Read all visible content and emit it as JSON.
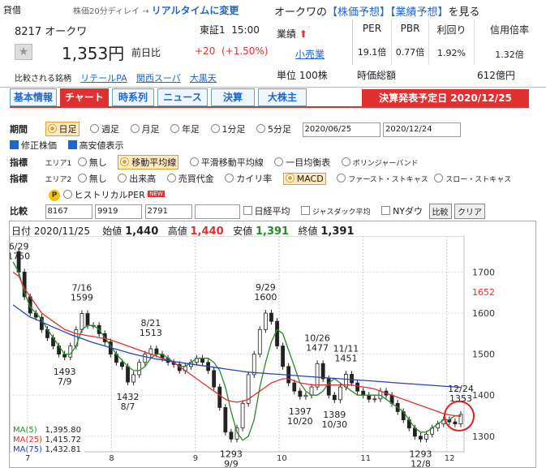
{
  "header": {
    "shinyo": "貸借",
    "delay_note": "株価20分ディレイ →",
    "realtime_link": "リアルタイムに変更",
    "company_short": "オークワの",
    "forecast_links": [
      "【株価予想】",
      "【業績予想】"
    ],
    "forecast_suffix": "を見る"
  },
  "stock": {
    "code": "8217",
    "name": "オークワ",
    "exchange": "東証1",
    "time": "15:00",
    "price": "1,353円",
    "prev_label": "前日比",
    "change": "+20",
    "change_pct": "(+1.50%)",
    "compare_label": "比較される銘柄",
    "compare_links": [
      "リテールPA",
      "関西スーパ",
      "大黒天"
    ],
    "gyoseki_label": "業績",
    "gyoseki_arrow": "⬆",
    "sector": "小売業",
    "unit": "単位 100株",
    "metrics": [
      {
        "h": "PER",
        "v": "19.1倍"
      },
      {
        "h": "PBR",
        "v": "0.77倍"
      },
      {
        "h": "利回り",
        "v": "1.92%"
      },
      {
        "h": "信用倍率",
        "v": "1.32倍"
      }
    ],
    "market_cap_label": "時価総額",
    "market_cap": "612億円"
  },
  "tabs": [
    "基本情報",
    "チャート",
    "時系列",
    "ニュース",
    "決算",
    "大株主"
  ],
  "kessan_banner": "決算発表予定日  2020/12/25",
  "controls": {
    "period_label": "期間",
    "periods": [
      "日足",
      "週足",
      "月足",
      "年足",
      "1分足",
      "5分足"
    ],
    "date_from": "2020/06/25",
    "date_to": "2020/12/24",
    "adjust_label": "修正株価",
    "hilo_label": "高安値表示",
    "indicator_label": "指標",
    "area1": "エリア1",
    "area1_opts": [
      "無し",
      "移動平均線",
      "平滑移動平均線",
      "一目均衡表",
      "ボリンジャーバンド"
    ],
    "area2": "エリア2",
    "area2_opts": [
      "無し",
      "出来高",
      "売買代金",
      "カイリ率",
      "MACD",
      "ファースト・ストキャス",
      "スロー・ストキャス"
    ],
    "per_opt": "ヒストリカルPER",
    "new_badge": "NEW",
    "compare_label": "比較",
    "compare_codes": [
      "8167",
      "9919",
      "2791",
      ""
    ],
    "nikkei": "日経平均",
    "jasdaq": "ジャスダック平均",
    "nydow": "NYダウ",
    "compare_btn": "比較",
    "clear_btn": "クリア"
  },
  "ohlc": {
    "date_label": "日付",
    "date": "2020/11/25",
    "open_label": "始値",
    "open": "1,440",
    "high_label": "高値",
    "high": "1,440",
    "low_label": "安値",
    "low": "1,391",
    "close_label": "終値",
    "close": "1,391"
  },
  "colors": {
    "up": "#e03030",
    "down": "#2a8a2a",
    "accent": "#2266cc",
    "ma5": "#2a8a2a",
    "ma25": "#e03030",
    "ma75": "#2244bb"
  },
  "chart_data": {
    "type": "line",
    "ylim": [
      1270,
      1780
    ],
    "yticks": [
      1300,
      1400,
      1500,
      1600,
      1700
    ],
    "last_price_label": "1652",
    "last_price": 1652,
    "xticks": [
      "7",
      "8",
      "9",
      "10",
      "11",
      "12"
    ],
    "series": [
      {
        "name": "MA(5)",
        "legend": "1,395.80",
        "values": [
          1725,
          1700,
          1650,
          1615,
          1600,
          1585,
          1560,
          1540,
          1520,
          1500,
          1500,
          1520,
          1560,
          1570,
          1570,
          1560,
          1540,
          1520,
          1500,
          1485,
          1470,
          1460,
          1460,
          1470,
          1490,
          1500,
          1500,
          1490,
          1480,
          1470,
          1470,
          1480,
          1490,
          1490,
          1490,
          1480,
          1460,
          1420,
          1360,
          1310,
          1290,
          1300,
          1340,
          1420,
          1480,
          1530,
          1560,
          1550,
          1510,
          1470,
          1430,
          1410,
          1400,
          1400,
          1410,
          1430,
          1440,
          1430,
          1420,
          1410,
          1400,
          1400,
          1400,
          1400,
          1400,
          1390,
          1380,
          1370,
          1360,
          1340,
          1320,
          1310,
          1310,
          1320,
          1330,
          1340,
          1340,
          1350,
          1350
        ]
      },
      {
        "name": "MA(25)",
        "legend": "1,415.72",
        "values": [
          1700,
          1690,
          1660,
          1640,
          1620,
          1600,
          1590,
          1580,
          1570,
          1560,
          1555,
          1550,
          1548,
          1545,
          1543,
          1540,
          1538,
          1535,
          1530,
          1525,
          1520,
          1515,
          1510,
          1505,
          1500,
          1495,
          1490,
          1485,
          1480,
          1470,
          1460,
          1450,
          1440,
          1430,
          1420,
          1410,
          1400,
          1390,
          1385,
          1383,
          1385,
          1390,
          1400,
          1410,
          1420,
          1430,
          1435,
          1440,
          1440,
          1435,
          1430,
          1428,
          1425,
          1425,
          1425,
          1425,
          1425,
          1425,
          1425,
          1425,
          1422,
          1420,
          1418,
          1415,
          1410,
          1405,
          1400,
          1395,
          1390,
          1385,
          1380,
          1375,
          1370,
          1365,
          1360,
          1355,
          1352,
          1350,
          1348
        ]
      },
      {
        "name": "MA(75)",
        "legend": "1,432.81",
        "values": [
          1620,
          1610,
          1600,
          1590,
          1585,
          1578,
          1572,
          1566,
          1560,
          1554,
          1548,
          1543,
          1538,
          1533,
          1528,
          1524,
          1520,
          1516,
          1512,
          1508,
          1504,
          1500,
          1497,
          1494,
          1491,
          1488,
          1486,
          1484,
          1482,
          1480,
          1478,
          1476,
          1474,
          1472,
          1470,
          1468,
          1466,
          1464,
          1462,
          1460,
          1458,
          1456,
          1455,
          1454,
          1453,
          1452,
          1451,
          1450,
          1449,
          1448,
          1447,
          1446,
          1445,
          1444,
          1443,
          1442,
          1441,
          1440,
          1439,
          1438,
          1437,
          1436,
          1435,
          1434,
          1433,
          1432,
          1431,
          1430,
          1429,
          1428,
          1427,
          1426,
          1425,
          1424,
          1423,
          1422,
          1421,
          1420,
          1419
        ]
      },
      {
        "name": "Close",
        "values": [
          1750,
          1700,
          1640,
          1600,
          1590,
          1560,
          1540,
          1520,
          1500,
          1493,
          1520,
          1560,
          1599,
          1570,
          1570,
          1550,
          1530,
          1500,
          1480,
          1470,
          1432,
          1450,
          1480,
          1500,
          1513,
          1500,
          1490,
          1480,
          1475,
          1460,
          1470,
          1480,
          1490,
          1480,
          1460,
          1420,
          1370,
          1310,
          1293,
          1320,
          1380,
          1450,
          1500,
          1560,
          1600,
          1580,
          1520,
          1470,
          1430,
          1410,
          1397,
          1400,
          1420,
          1477,
          1440,
          1400,
          1389,
          1420,
          1451,
          1430,
          1410,
          1400,
          1390,
          1391,
          1410,
          1400,
          1380,
          1360,
          1340,
          1320,
          1300,
          1293,
          1305,
          1320,
          1330,
          1340,
          1335,
          1330,
          1353
        ]
      }
    ],
    "annotations": [
      {
        "label": "6/29",
        "value": "1750"
      },
      {
        "label": "7/16",
        "value": "1599"
      },
      {
        "label": "7/9",
        "value": "1493"
      },
      {
        "label": "8/7",
        "value": "1432"
      },
      {
        "label": "8/21",
        "value": "1513"
      },
      {
        "label": "9/9",
        "value": "1293"
      },
      {
        "label": "9/29",
        "value": "1600"
      },
      {
        "label": "10/26",
        "value": "1477"
      },
      {
        "label": "10/20",
        "value": "1397"
      },
      {
        "label": "10/30",
        "value": "1389"
      },
      {
        "label": "11/11",
        "value": "1451"
      },
      {
        "label": "12/8",
        "value": "1293"
      },
      {
        "label": "12/24",
        "value": "1353"
      }
    ]
  }
}
